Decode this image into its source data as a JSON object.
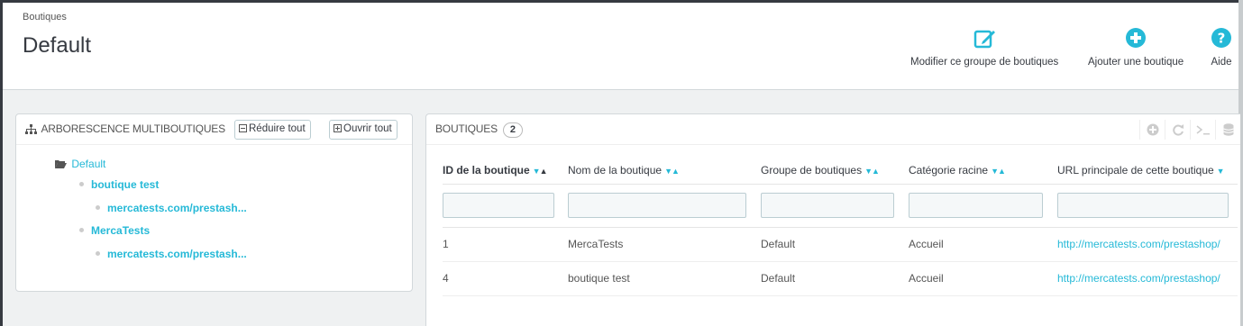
{
  "header": {
    "breadcrumb": "Boutiques",
    "title": "Default",
    "toolbar": [
      {
        "label": "Modifier ce groupe de boutiques",
        "icon": "edit-icon"
      },
      {
        "label": "Ajouter une boutique",
        "icon": "add-circle-icon"
      },
      {
        "label": "Aide",
        "icon": "help-icon"
      }
    ]
  },
  "tree_panel": {
    "title": "ARBORESCENCE MULTIBOUTIQUES",
    "collapse_label": "Réduire tout",
    "expand_label": "Ouvrir tout",
    "root": "Default",
    "shops": [
      {
        "name": "boutique test",
        "url": "mercatests.com/prestash..."
      },
      {
        "name": "MercaTests",
        "url": "mercatests.com/prestash..."
      }
    ]
  },
  "shops_panel": {
    "title": "BOUTIQUES",
    "count": "2",
    "columns": [
      "ID de la boutique",
      "Nom de la boutique",
      "Groupe de boutiques",
      "Catégorie racine",
      "URL principale de cette boutique"
    ],
    "rows": [
      [
        "1",
        "MercaTests",
        "Default",
        "Accueil",
        "http://mercatests.com/prestashop/"
      ],
      [
        "4",
        "boutique test",
        "Default",
        "Accueil",
        "http://mercatests.com/prestashop/"
      ]
    ]
  },
  "colors": {
    "accent": "#25b9d7",
    "dark": "#363a41",
    "frame": "#363a41"
  }
}
